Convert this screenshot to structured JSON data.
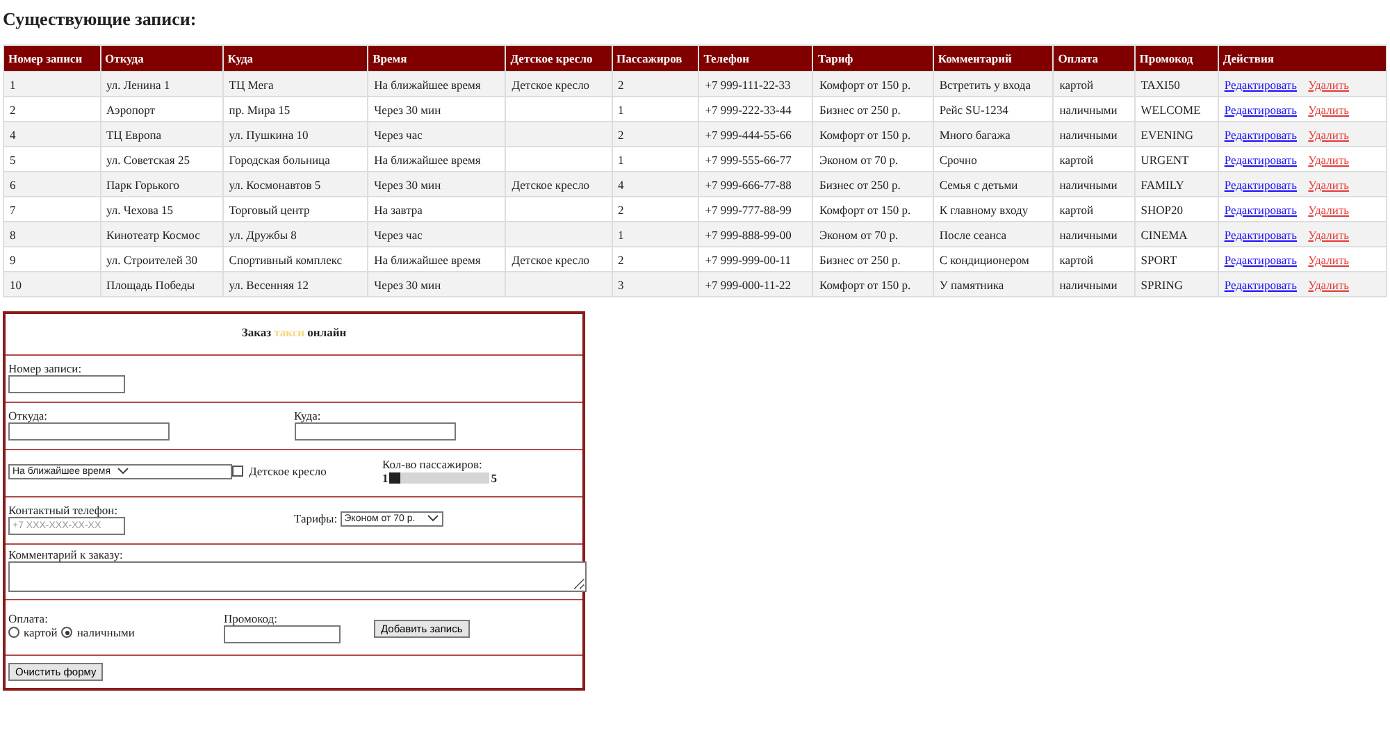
{
  "heading": "Существующие записи:",
  "table": {
    "columns": [
      "Номер записи",
      "Откуда",
      "Куда",
      "Время",
      "Детское кресло",
      "Пассажиров",
      "Телефон",
      "Тариф",
      "Комментарий",
      "Оплата",
      "Промокод",
      "Действия"
    ],
    "rows": [
      {
        "cells": [
          "1",
          "ул. Ленина 1",
          "ТЦ Мега",
          "На ближайшее время",
          "Детское кресло",
          "2",
          "+7 999-111-22-33",
          "Комфорт от 150 р.",
          "Встретить у входа",
          "картой",
          "TAXI50"
        ],
        "edit": "Редактировать",
        "delete": "Удалить"
      },
      {
        "cells": [
          "2",
          "Аэропорт",
          "пр. Мира 15",
          "Через 30 мин",
          "",
          "1",
          "+7 999-222-33-44",
          "Бизнес от 250 р.",
          "Рейс SU-1234",
          "наличными",
          "WELCOME"
        ],
        "edit": "Редактировать",
        "delete": "Удалить"
      },
      {
        "cells": [
          "4",
          "ТЦ Европа",
          "ул. Пушкина 10",
          "Через час",
          "",
          "2",
          "+7 999-444-55-66",
          "Комфорт от 150 р.",
          "Много багажа",
          "наличными",
          "EVENING"
        ],
        "edit": "Редактировать",
        "delete": "Удалить"
      },
      {
        "cells": [
          "5",
          "ул. Советская 25",
          "Городская больница",
          "На ближайшее время",
          "",
          "1",
          "+7 999-555-66-77",
          "Эконом от 70 р.",
          "Срочно",
          "картой",
          "URGENT"
        ],
        "edit": "Редактировать",
        "delete": "Удалить"
      },
      {
        "cells": [
          "6",
          "Парк Горького",
          "ул. Космонавтов 5",
          "Через 30 мин",
          "Детское кресло",
          "4",
          "+7 999-666-77-88",
          "Бизнес от 250 р.",
          "Семья с детьми",
          "наличными",
          "FAMILY"
        ],
        "edit": "Редактировать",
        "delete": "Удалить"
      },
      {
        "cells": [
          "7",
          "ул. Чехова 15",
          "Торговый центр",
          "На завтра",
          "",
          "2",
          "+7 999-777-88-99",
          "Комфорт от 150 р.",
          "К главному входу",
          "картой",
          "SHOP20"
        ],
        "edit": "Редактировать",
        "delete": "Удалить"
      },
      {
        "cells": [
          "8",
          "Кинотеатр Космос",
          "ул. Дружбы 8",
          "Через час",
          "",
          "1",
          "+7 999-888-99-00",
          "Эконом от 70 р.",
          "После сеанса",
          "наличными",
          "CINEMA"
        ],
        "edit": "Редактировать",
        "delete": "Удалить"
      },
      {
        "cells": [
          "9",
          "ул. Строителей 30",
          "Спортивный комплекс",
          "На ближайшее время",
          "Детское кресло",
          "2",
          "+7 999-999-00-11",
          "Бизнес от 250 р.",
          "С кондиционером",
          "картой",
          "SPORT"
        ],
        "edit": "Редактировать",
        "delete": "Удалить"
      },
      {
        "cells": [
          "10",
          "Площадь Победы",
          "ул. Весенняя 12",
          "Через 30 мин",
          "",
          "3",
          "+7 999-000-11-22",
          "Комфорт от 150 р.",
          "У памятника",
          "наличными",
          "SPRING"
        ],
        "edit": "Редактировать",
        "delete": "Удалить"
      }
    ]
  },
  "form": {
    "title_before": "Заказ",
    "title_highlight": "такси",
    "title_after": "онлайн",
    "record_label": "Номер записи:",
    "from_label": "Откуда:",
    "to_label": "Куда:",
    "time_select": "На ближайшее время",
    "child_seat": {
      "label": "Детское кресло",
      "checked": false
    },
    "passengers": {
      "label": "Кол-во пассажиров:",
      "min": "1",
      "max": "5",
      "level": 0
    },
    "phone": {
      "label": "Контактный телефон:",
      "placeholder": "+7 XXX-XXX-XX-XX"
    },
    "tariff": {
      "label": "Тарифы:",
      "value": "Эконом от 70 р."
    },
    "comment_label": "Комментарий к заказу:",
    "payment": {
      "label": "Оплата:",
      "options": [
        {
          "label": "картой",
          "selected": false
        },
        {
          "label": "наличными",
          "selected": true
        }
      ]
    },
    "promo_label": "Промокод:",
    "add_button": "Добавить запись",
    "clear_button": "Очистить форму"
  }
}
